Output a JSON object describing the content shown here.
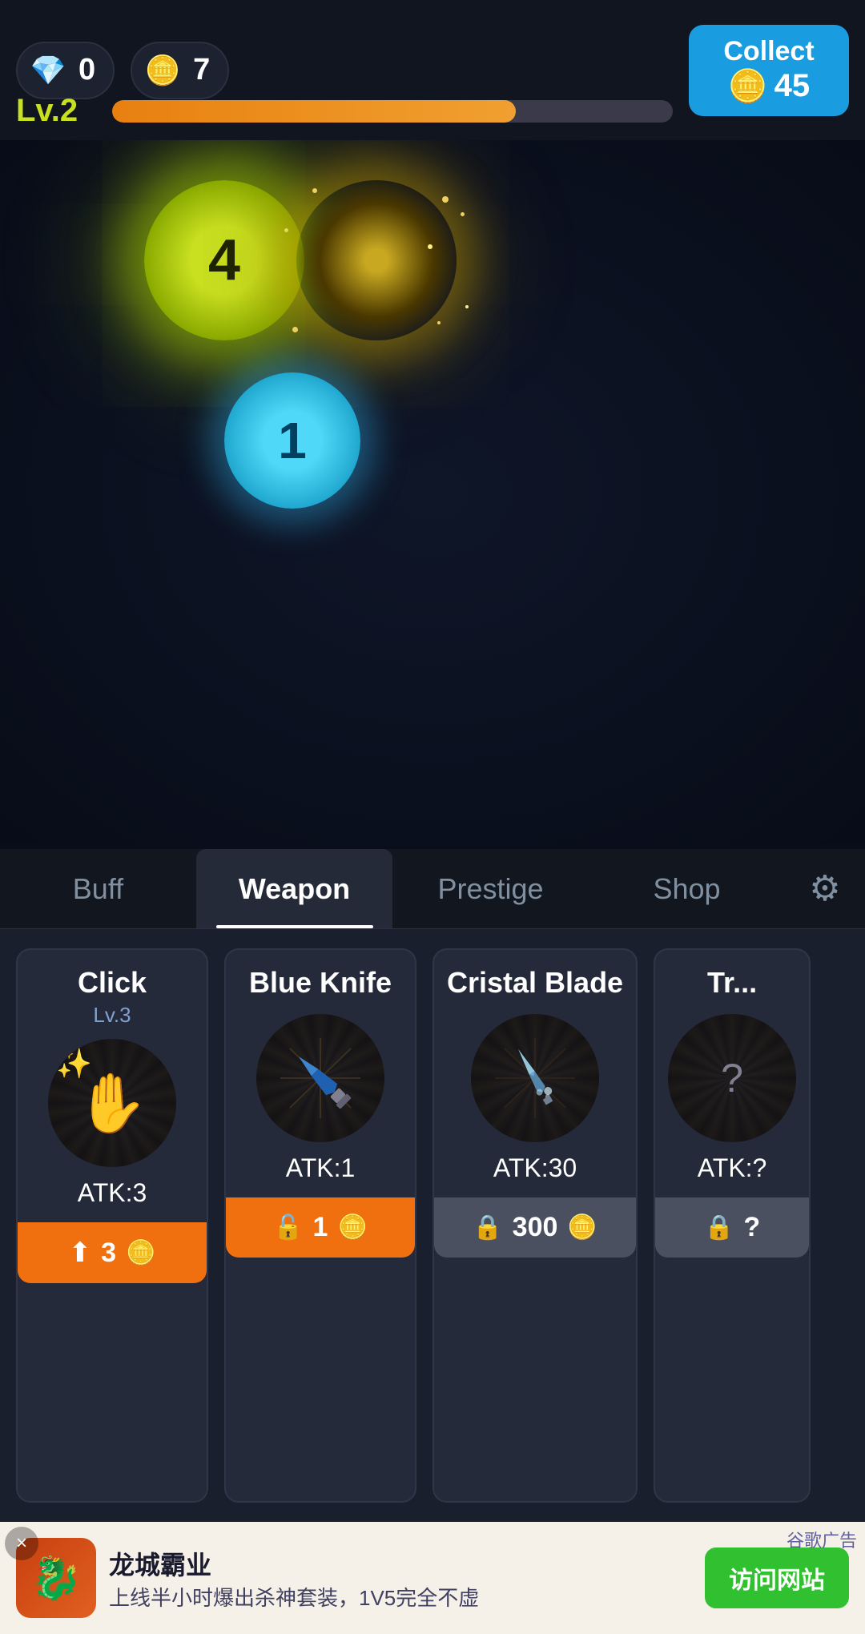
{
  "topbar": {
    "diamond_amount": "0",
    "coin_amount": "7",
    "collect_label": "Collect",
    "collect_amount": "45",
    "level_label": "Lv.2",
    "xp_percent": 72
  },
  "game": {
    "orb_green_number": "4",
    "orb_blue_number": "1"
  },
  "tabs": [
    {
      "id": "buff",
      "label": "Buff",
      "active": false
    },
    {
      "id": "weapon",
      "label": "Weapon",
      "active": true
    },
    {
      "id": "prestige",
      "label": "Prestige",
      "active": false
    },
    {
      "id": "shop",
      "label": "Shop",
      "active": false
    }
  ],
  "weapons": [
    {
      "name": "Click",
      "level": "Lv.3",
      "icon_type": "click",
      "atk": "ATK:3",
      "btn_type": "upgrade",
      "btn_cost": "3",
      "locked": false
    },
    {
      "name": "Blue Knife",
      "level": "",
      "icon_type": "knife",
      "atk": "ATK:1",
      "btn_type": "unlock",
      "btn_cost": "1",
      "locked": false
    },
    {
      "name": "Cristal Blade",
      "level": "",
      "icon_type": "blade",
      "atk": "ATK:30",
      "btn_type": "locked",
      "btn_cost": "300",
      "locked": true
    },
    {
      "name": "Tr...",
      "level": "",
      "icon_type": "unknown",
      "atk": "ATK:?",
      "btn_type": "locked",
      "btn_cost": "?",
      "locked": true
    }
  ],
  "ad": {
    "close_label": "×",
    "app_icon": "🐉",
    "title": "龙城霸业",
    "subtitle": "上线半小时爆出杀神套装，1V5完全不虚",
    "visit_label": "访问网站",
    "ad_label": "谷歌广告"
  },
  "icons": {
    "diamond": "💎",
    "coin": "🪙",
    "coin_small": "🪙",
    "gear": "⚙",
    "arrow_up": "↑",
    "lock": "🔒",
    "unlock": "🔓"
  }
}
